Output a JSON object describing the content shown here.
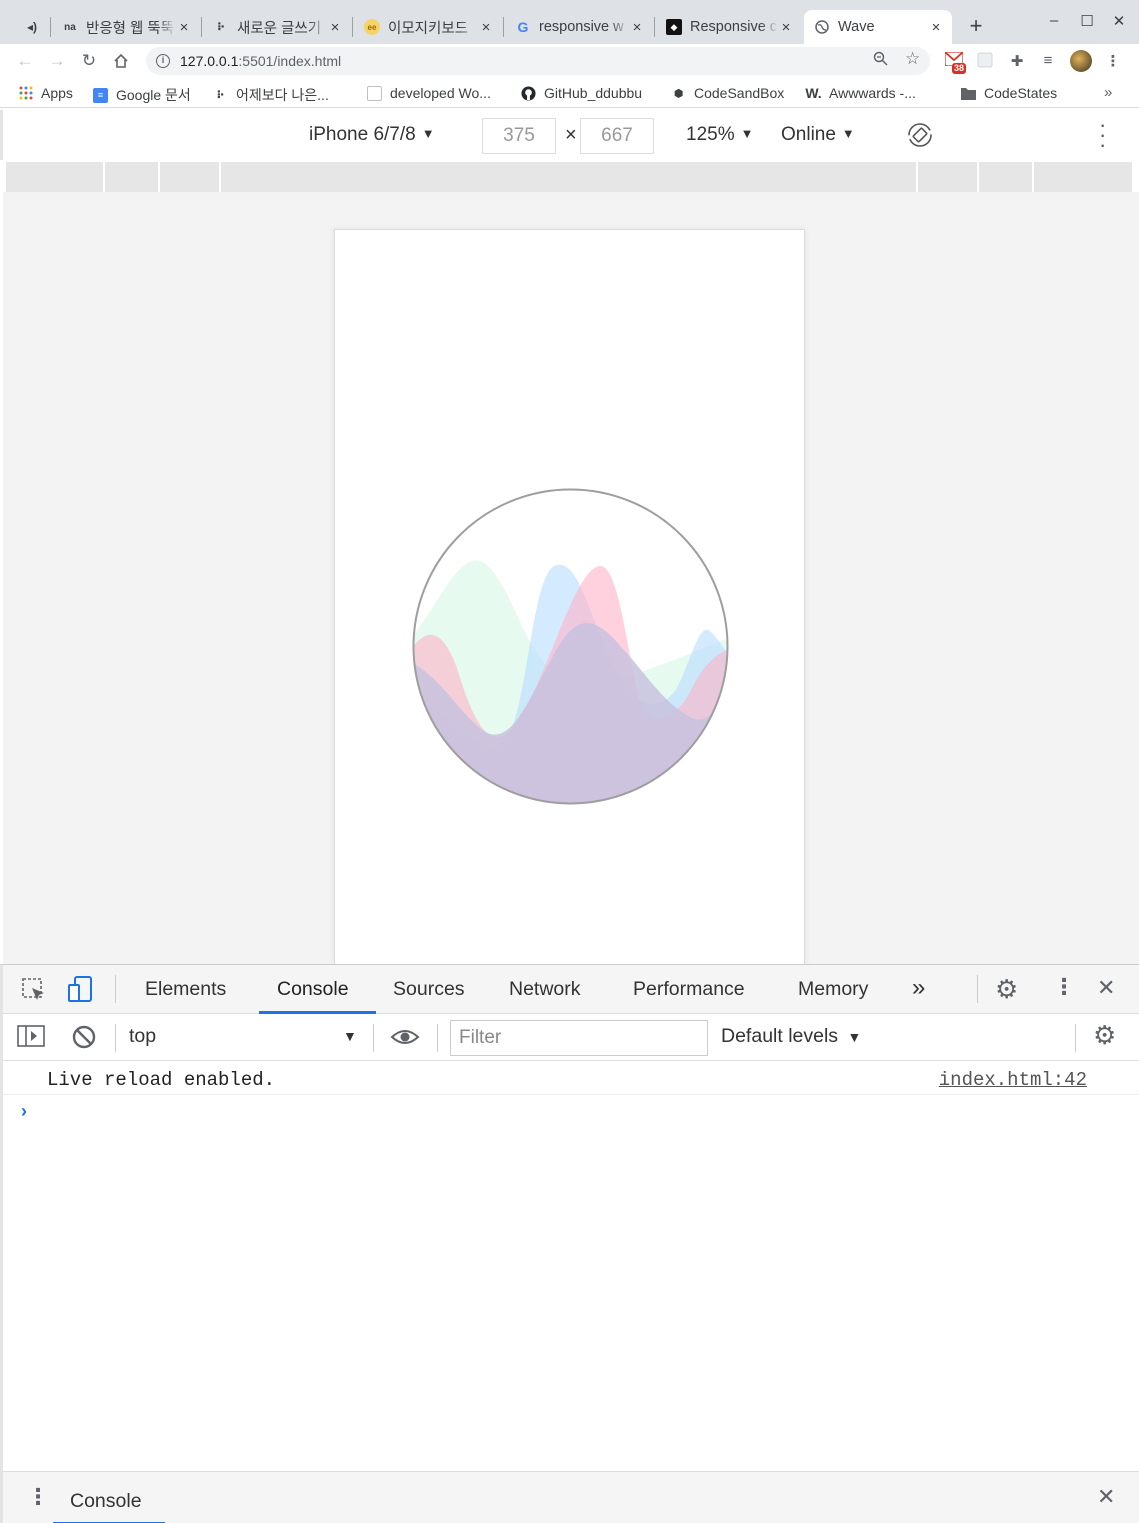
{
  "browser": {
    "tabs": [
      {
        "title": "반응형 웹 뚝뚝",
        "favicon": "audio-icon"
      },
      {
        "title": "새로운 글쓰기",
        "favicon": "dots-icon"
      },
      {
        "title": "이모지키보드",
        "favicon": "ee-icon"
      },
      {
        "title": "responsive w",
        "favicon": "google-icon"
      },
      {
        "title": "Responsive c",
        "favicon": "codepen-icon"
      },
      {
        "title": "Wave",
        "favicon": "globe-icon"
      }
    ],
    "tab_close": "×",
    "new_tab": "+",
    "url_host": "127.0.0.1",
    "url_path": ":5501/index.html",
    "gmail_count": "38",
    "bookmarks": [
      {
        "label": "Apps"
      },
      {
        "label": "Google 문서"
      },
      {
        "label": "어제보다 나은..."
      },
      {
        "label": "developed Wo..."
      },
      {
        "label": "GitHub_ddubbu"
      },
      {
        "label": "CodeSandBox"
      },
      {
        "label": "Awwwards -..."
      },
      {
        "label": "CodeStates"
      }
    ],
    "bookmarks_more": "»"
  },
  "device_toolbar": {
    "device": "iPhone 6/7/8",
    "width": "375",
    "height": "667",
    "times": "×",
    "zoom": "125%",
    "throttle": "Online",
    "caret": "▼"
  },
  "wave": {
    "colors": {
      "green": "#d9f7e6",
      "blue": "#b8dcff",
      "pink": "#ffb3c8",
      "purple": "#c8c2df",
      "border": "#9e9e9e"
    }
  },
  "devtools": {
    "tabs": [
      "Elements",
      "Console",
      "Sources",
      "Network",
      "Performance",
      "Memory"
    ],
    "more_tabs": "»",
    "context": "top",
    "filter_placeholder": "Filter",
    "levels": "Default levels",
    "messages": [
      {
        "text": "Live reload enabled.",
        "source": "index.html:42"
      }
    ],
    "prompt": "›",
    "drawer_tab": "Console",
    "accent": "#1a73e8"
  }
}
